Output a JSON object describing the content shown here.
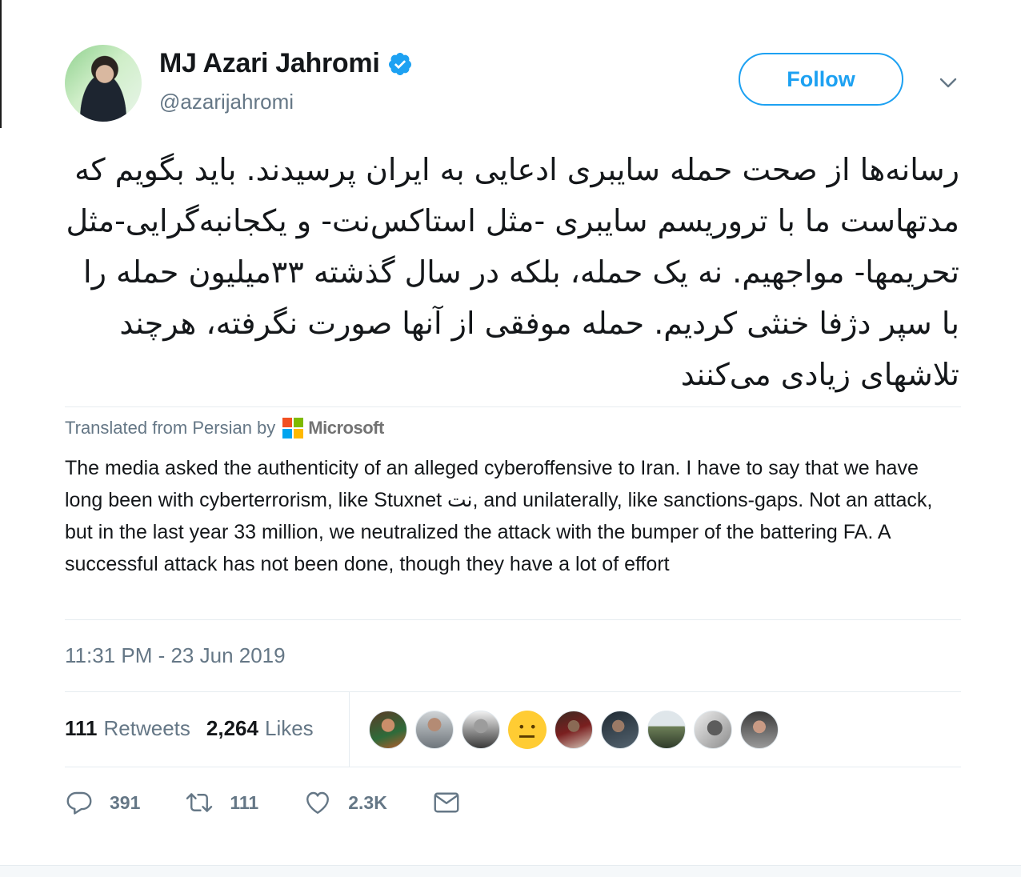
{
  "author": {
    "display_name": "MJ Azari Jahromi",
    "handle": "@azarijahromi",
    "verified": true,
    "verified_color": "#1da1f2"
  },
  "follow_button": {
    "label": "Follow"
  },
  "tweet": {
    "text_persian": "رسانه‌ها از صحت حمله سایبری ادعایی به ایران پرسیدند. باید بگویم که مدتهاست ما با تروریسم سایبری -مثل استاکس‌نت- و یکجانبه‌گرایی-مثل تحریمها- مواجهیم. نه یک حمله، بلکه در سال گذشته ۳۳میلیون حمله را با سپر دژفا خنثی کردیم. حمله موفقی از آنها صورت نگرفته، هرچند تلاشهای زیادی می‌کنند",
    "translated_label": "Translated from Persian by",
    "translator": "Microsoft",
    "translation": "The media asked the authenticity of an alleged cyberoffensive to Iran. I have to say that we have long been with cyberterrorism, like Stuxnet نت, and unilaterally, like sanctions-gaps. Not an attack, but in the last year 33 million, we neutralized the attack with the bumper of the battering FA. A successful attack has not been done, though they have a lot of effort",
    "timestamp": "11:31 PM - 23 Jun 2019"
  },
  "stats": {
    "retweets_count": "111",
    "retweets_label": "Retweets",
    "likes_count": "2,264",
    "likes_label": "Likes"
  },
  "actions": {
    "reply_count": "391",
    "retweet_count": "111",
    "like_count": "2.3K"
  },
  "colors": {
    "accent": "#1da1f2",
    "secondary_text": "#657786",
    "divider": "#e6ecf0"
  },
  "icons": [
    "verified-badge-icon",
    "chevron-down-icon",
    "microsoft-logo-icon",
    "reply-icon",
    "retweet-icon",
    "heart-icon",
    "mail-icon"
  ]
}
